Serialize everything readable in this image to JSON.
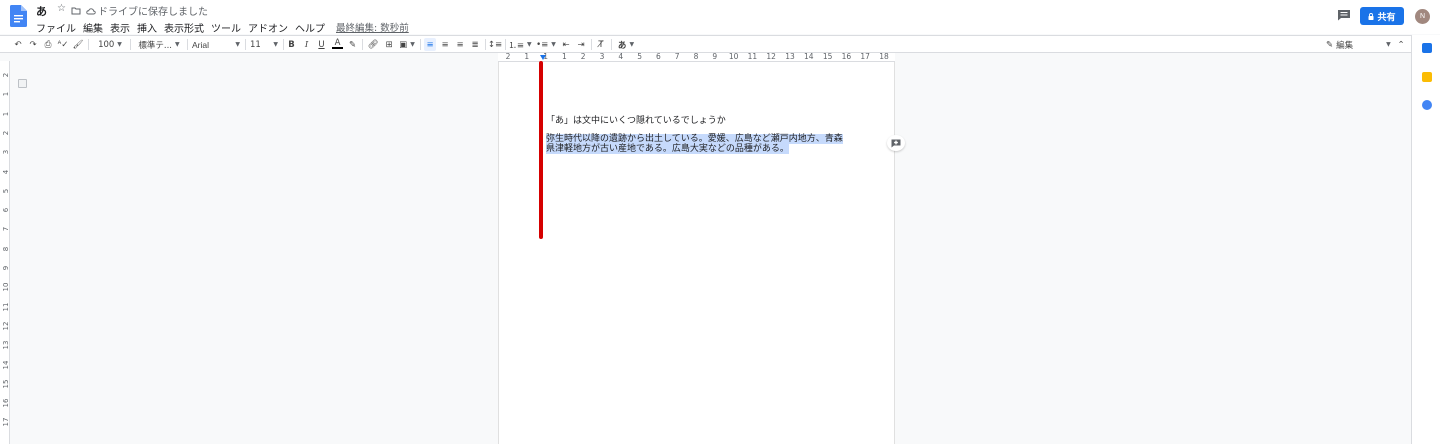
{
  "doc": {
    "title": "あ",
    "save_status": "ドライブに保存しました"
  },
  "menus": [
    "ファイル",
    "編集",
    "表示",
    "挿入",
    "表示形式",
    "ツール",
    "アドオン",
    "ヘルプ"
  ],
  "last_edit": "最終編集: 数秒前",
  "share": {
    "label": "共有",
    "avatar_initial": "N"
  },
  "toolbar": {
    "zoom": "100",
    "style": "標準テ...",
    "font": "Arial",
    "font_size": "11",
    "bold": "B",
    "italic": "I",
    "underline": "U",
    "text_color": "A",
    "input_tool": "あ",
    "mode": "編集"
  },
  "ruler": {
    "horizontal": [
      "2",
      "1",
      "1",
      "1",
      "2",
      "3",
      "4",
      "5",
      "6",
      "7",
      "8",
      "9",
      "10",
      "11",
      "12",
      "13",
      "14",
      "15",
      "16",
      "17",
      "18"
    ],
    "vertical": [
      "2",
      "1",
      "1",
      "2",
      "3",
      "4",
      "5",
      "6",
      "7",
      "8",
      "9",
      "10",
      "11",
      "12",
      "13",
      "14",
      "15",
      "16",
      "17"
    ]
  },
  "content": {
    "line1": "「あ」は文中にいくつ隠れているでしょうか",
    "selected_line1": "弥生時代以降の遺跡から出土している。愛媛、広島など瀬戸内地方、青森",
    "selected_line2": "県津軽地方が古い産地である。広島大実などの品種がある。"
  },
  "colors": {
    "accent": "#1a73e8",
    "selection": "#c6dafc",
    "marker": "#d50000"
  }
}
